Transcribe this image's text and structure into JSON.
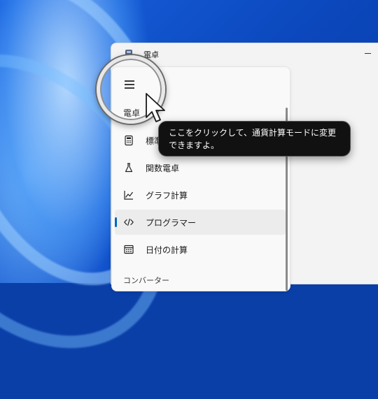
{
  "window": {
    "title": "電卓"
  },
  "nav": {
    "section_title": "電卓",
    "items": [
      {
        "label": "標準",
        "icon": "calculator-icon"
      },
      {
        "label": "関数電卓",
        "icon": "flask-icon"
      },
      {
        "label": "グラフ計算",
        "icon": "graph-icon"
      },
      {
        "label": "プログラマー",
        "icon": "code-icon",
        "selected": true
      },
      {
        "label": "日付の計算",
        "icon": "calendar-icon"
      }
    ],
    "converter_title": "コンバーター"
  },
  "tooltip": {
    "text": "ここをクリックして、通貨計算モードに変更できますよ。"
  },
  "colors": {
    "accent": "#0067c0",
    "tooltip_bg": "#111111"
  }
}
